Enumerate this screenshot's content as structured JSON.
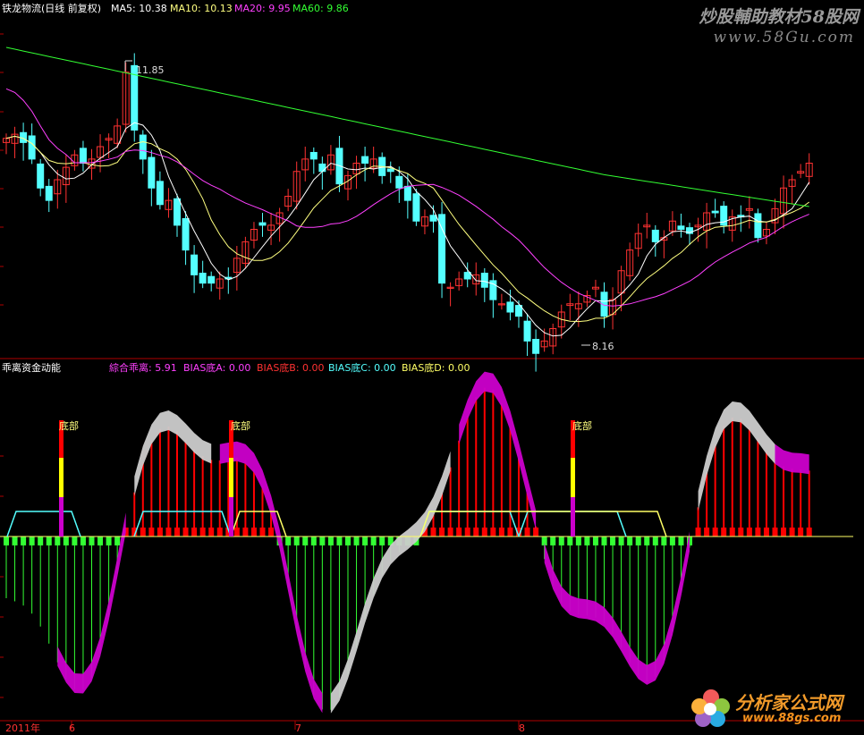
{
  "top_panel": {
    "title": "铁龙物流(日线 前复权)",
    "ma5_label": "MA5: 10.38",
    "ma10_label": "MA10: 10.13",
    "ma20_label": "MA20: 9.95",
    "ma60_label": "MA60: 9.86",
    "high_marker": "11.85",
    "low_marker": "8.16"
  },
  "watermark": {
    "line1": "炒股輔助教材58股网",
    "line2": "www.58Gu.com"
  },
  "bottom_panel": {
    "title": "乖离资金动能",
    "composite_label": "綜合乖离: 5.91",
    "bias_a_label": "BIAS底A: 0.00",
    "bias_b_label": "BIAS底B: 0.00",
    "bias_c_label": "BIAS底C: 0.00",
    "bias_d_label": "BIAS底D: 0.00",
    "bottom_tag": "底部"
  },
  "x_axis": {
    "year_label": "2011年",
    "month_labels": [
      "6",
      "7",
      "8"
    ]
  },
  "logo": {
    "name": "分析家公式网",
    "url": "www.88gs.com"
  },
  "colors": {
    "up": "#ff3232",
    "down": "#54ffff",
    "ma5": "#ffffff",
    "ma10": "#ffff80",
    "ma20": "#ff40ff",
    "ma60": "#33ff33",
    "magenta_fill": "#cc00cc",
    "grey_fill": "#cccccc",
    "bar_red": "#ff0000",
    "bar_green": "#33ff33",
    "trap_cyan": "#54ffff",
    "trap_yellow": "#ffff66"
  },
  "chart_data": {
    "type": "candlestick",
    "closes": [
      10.8,
      10.85,
      10.75,
      10.55,
      10.2,
      10.05,
      10.3,
      10.45,
      10.6,
      10.5,
      10.55,
      10.7,
      10.8,
      10.95,
      11.6,
      10.9,
      10.55,
      10.2,
      10.0,
      10.05,
      9.75,
      9.45,
      9.15,
      9.05,
      9.05,
      9.1,
      9.1,
      9.35,
      9.55,
      9.7,
      9.75,
      9.75,
      9.9,
      10.1,
      10.4,
      10.55,
      10.55,
      10.4,
      10.6,
      10.25,
      10.35,
      10.5,
      10.5,
      10.55,
      10.35,
      10.4,
      10.2,
      10.05,
      9.8,
      9.85,
      9.8,
      9.05,
      9.0,
      9.1,
      9.1,
      9.15,
      9.0,
      8.85,
      8.8,
      8.7,
      8.65,
      8.35,
      8.2,
      8.35,
      8.5,
      8.7,
      8.8,
      8.8,
      8.9,
      9.0,
      8.65,
      8.85,
      9.2,
      9.45,
      9.65,
      9.75,
      9.55,
      9.6,
      9.8,
      9.7,
      9.65,
      9.75,
      9.9,
      9.9,
      9.75,
      9.85,
      9.85,
      9.95,
      9.6,
      9.7,
      9.95,
      10.2,
      10.3,
      10.4,
      10.5
    ],
    "bias_composite": 5.91,
    "bias_bottom_a": 0.0,
    "bias_bottom_b": 0.0,
    "bias_bottom_c": 0.0,
    "bias_bottom_d": 0.0,
    "bottom_signal_indices": [
      8,
      40,
      72
    ]
  }
}
